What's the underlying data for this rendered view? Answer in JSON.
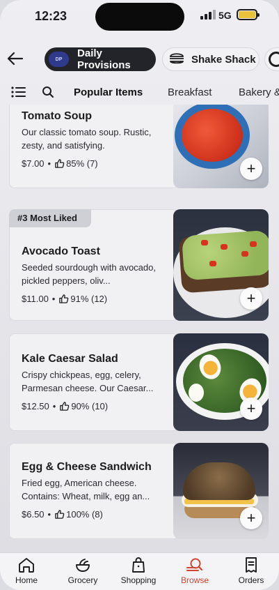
{
  "status_bar": {
    "time": "12:23",
    "network": "5G",
    "battery_color": "#e8c23a"
  },
  "header": {
    "back_icon": "arrow-left-icon",
    "stores": [
      {
        "label": "Daily Provisions",
        "active": true
      },
      {
        "label": "Shake Shack",
        "active": false
      }
    ]
  },
  "tabs": {
    "list_icon": "list-icon",
    "search_icon": "search-icon",
    "items": [
      "Popular Items",
      "Breakfast",
      "Bakery &"
    ],
    "active": "Popular Items"
  },
  "menu_items": [
    {
      "badge": "",
      "name": "Tomato Soup",
      "description": "Our classic tomato soup. Rustic, zesty, and satisfying.",
      "price": "$7.00",
      "rating": "85% (7)"
    },
    {
      "badge": "#3 Most Liked",
      "name": "Avocado Toast",
      "description": "Seeded sourdough with avocado, pickled peppers, oliv...",
      "price": "$11.00",
      "rating": "91% (12)"
    },
    {
      "badge": "",
      "name": "Kale Caesar Salad",
      "description": "Crispy chickpeas, egg, celery, Parmesan cheese. Our Caesar...",
      "price": "$12.50",
      "rating": "90% (10)"
    },
    {
      "badge": "",
      "name": "Egg & Cheese Sandwich",
      "description": "Fried egg, American cheese. Contains: Wheat, milk, egg an...",
      "price": "$6.50",
      "rating": "100% (8)"
    }
  ],
  "add_label": "+",
  "bottom_nav": [
    {
      "label": "Home",
      "icon": "home-icon"
    },
    {
      "label": "Grocery",
      "icon": "grocery-icon"
    },
    {
      "label": "Shopping",
      "icon": "shopping-bag-icon"
    },
    {
      "label": "Browse",
      "icon": "browse-icon",
      "active": true
    },
    {
      "label": "Orders",
      "icon": "orders-icon"
    }
  ],
  "colors": {
    "accent": "#d1442f",
    "active_chip": "#23232a"
  }
}
